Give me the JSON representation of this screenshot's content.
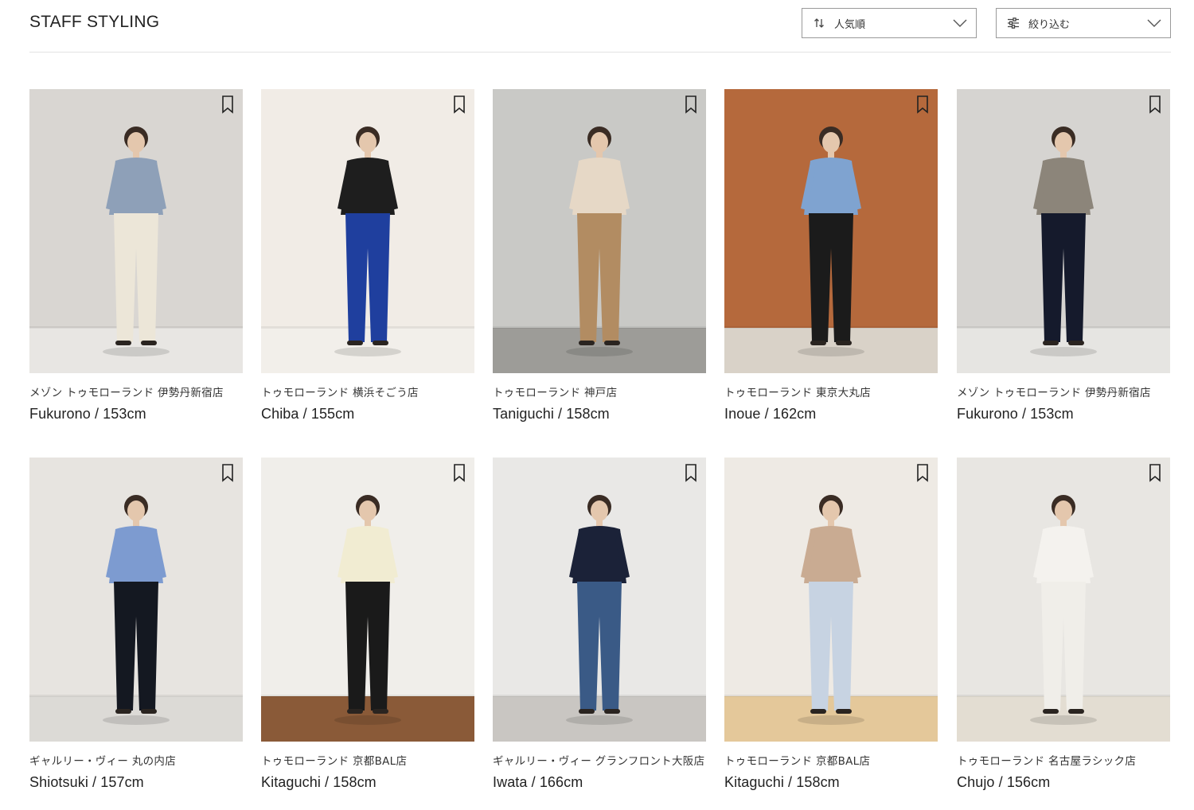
{
  "header": {
    "title": "STAFF STYLING",
    "sort": {
      "label": "人気順",
      "icon": "sort-arrows-icon"
    },
    "filter": {
      "label": "絞り込む",
      "icon": "filter-sliders-icon"
    }
  },
  "colors": {
    "border": "#9a9a9a",
    "divider": "#e3e3e3",
    "text": "#222222"
  },
  "cards": [
    {
      "shop": "メゾン トゥモローランド 伊勢丹新宿店",
      "staff": "Fukurono / 153cm",
      "bg": "#d9d6d2",
      "floor": "#e8e6e3",
      "top": "#8ea0b8",
      "bottom": "#ece6d8"
    },
    {
      "shop": "トゥモローランド 横浜そごう店",
      "staff": "Chiba / 155cm",
      "bg": "#f1ece6",
      "floor": "#f2efea",
      "top": "#1e1e1e",
      "bottom": "#1f3f9e"
    },
    {
      "shop": "トゥモローランド 神戸店",
      "staff": "Taniguchi / 158cm",
      "bg": "#c9c9c6",
      "floor": "#9d9c98",
      "top": "#e6d8c6",
      "bottom": "#b28c62"
    },
    {
      "shop": "トゥモローランド 東京大丸店",
      "staff": "Inoue / 162cm",
      "bg": "#b5693c",
      "floor": "#d9d2c8",
      "top": "#7fa3d0",
      "bottom": "#1b1b1b"
    },
    {
      "shop": "メゾン トゥモローランド 伊勢丹新宿店",
      "staff": "Fukurono / 153cm",
      "bg": "#d6d4d1",
      "floor": "#e6e5e2",
      "top": "#8c857a",
      "bottom": "#151a2c"
    },
    {
      "shop": "ギャルリー・ヴィー 丸の内店",
      "staff": "Shiotsuki / 157cm",
      "bg": "#e7e4e0",
      "floor": "#dcdad6",
      "top": "#7d9bd0",
      "bottom": "#141821"
    },
    {
      "shop": "トゥモローランド 京都BAL店",
      "staff": "Kitaguchi / 158cm",
      "bg": "#f0eeea",
      "floor": "#8a5a38",
      "top": "#f1ecd2",
      "bottom": "#1a1a1a"
    },
    {
      "shop": "ギャルリー・ヴィー グランフロント大阪店",
      "staff": "Iwata / 166cm",
      "bg": "#e9e8e6",
      "floor": "#c9c6c2",
      "top": "#1b2238",
      "bottom": "#3a5a86"
    },
    {
      "shop": "トゥモローランド 京都BAL店",
      "staff": "Kitaguchi / 158cm",
      "bg": "#eeeae4",
      "floor": "#e4c89a",
      "top": "#c9ab92",
      "bottom": "#c7d3e2"
    },
    {
      "shop": "トゥモローランド 名古屋ラシック店",
      "staff": "Chujo / 156cm",
      "bg": "#e8e6e2",
      "floor": "#e3ddd2",
      "top": "#f4f2ee",
      "bottom": "#f0eee9"
    }
  ]
}
